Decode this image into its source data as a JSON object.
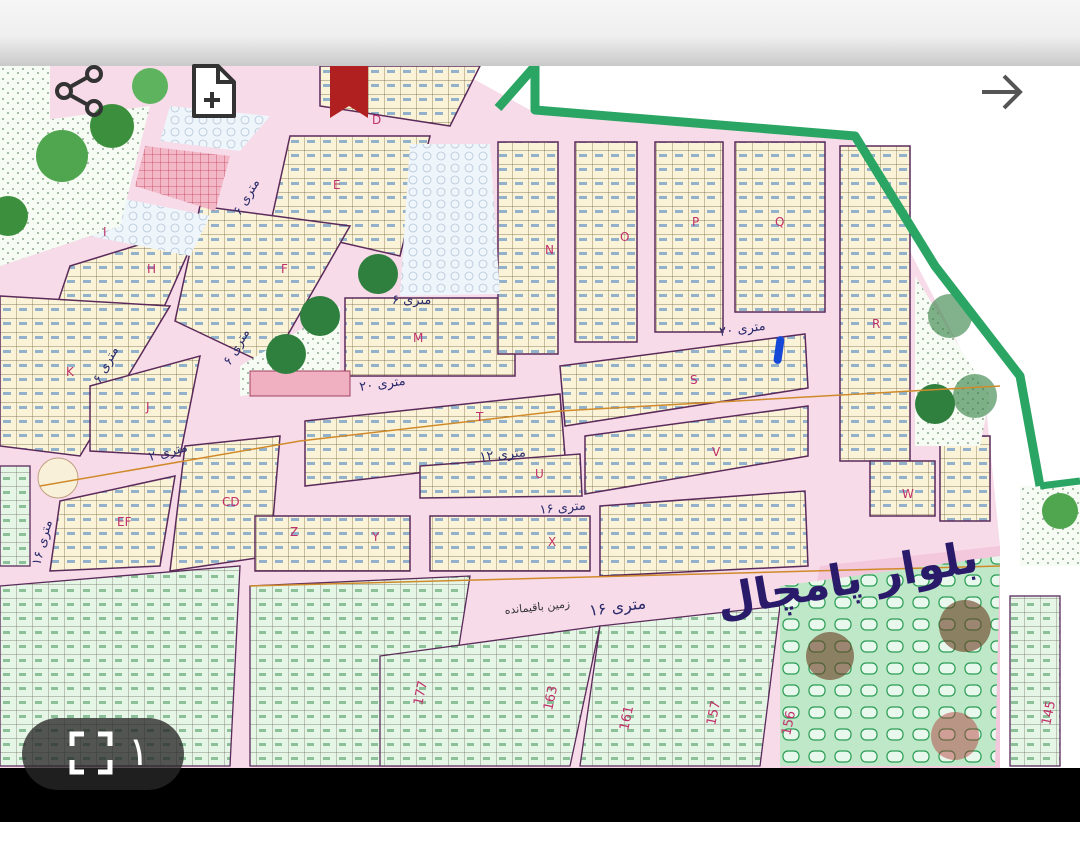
{
  "toolbar": {
    "share_icon": "share-icon",
    "add_file_icon": "add-file-icon",
    "bookmark_icon": "bookmark-icon",
    "forward_icon": "arrow-right-icon",
    "bookmark_color": "#b02020"
  },
  "map": {
    "road_color": "#f5c2dc",
    "park_color": "#2a9d55",
    "boundary_color": "#2aa563",
    "block_labels": [
      "D",
      "E",
      "F",
      "H",
      "I",
      "K",
      "J",
      "M",
      "N",
      "O",
      "P",
      "Q",
      "R",
      "S",
      "T",
      "U",
      "V",
      "W",
      "CD",
      "EF",
      "X",
      "Y",
      "Z"
    ],
    "street_labels": [
      "۲۰ متری",
      "۲۰ متری",
      "۱۲ متری",
      "۱۶ متری",
      "۶ متری",
      "۶ متری",
      "۶ متری",
      "۶ متری",
      "۲ متری",
      "۱۶ متری"
    ],
    "boulevard_label": "بلوار پامچال",
    "side_label": "زمین باقیمانده",
    "sixteen_label": "۱۶ متری",
    "lower_numbers": [
      "177",
      "163",
      "161",
      "156",
      "157",
      "145"
    ]
  },
  "viewer": {
    "page_count": "۱",
    "fullscreen_icon": "fullscreen-icon"
  }
}
